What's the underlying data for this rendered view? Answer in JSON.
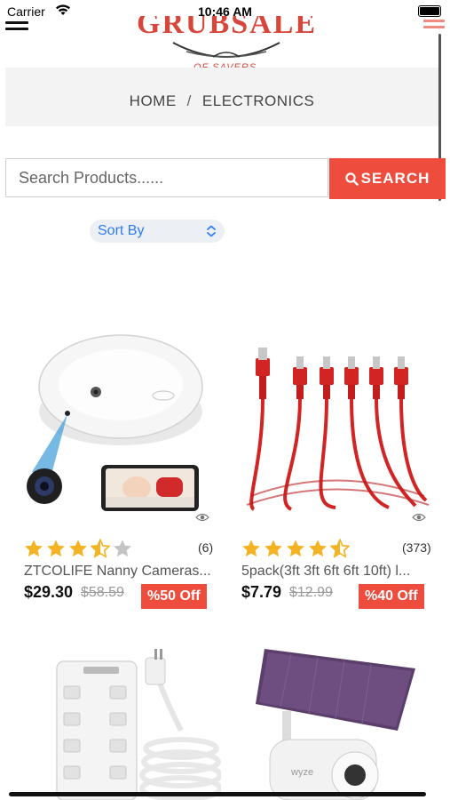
{
  "status_bar": {
    "carrier": "Carrier",
    "time": "10:46 AM"
  },
  "header": {
    "logo_text": "GRUBSALE",
    "logo_sub": "OF SAVERS"
  },
  "breadcrumb": {
    "home": "HOME",
    "separator": "/",
    "current": "ELECTRONICS"
  },
  "search": {
    "placeholder": "Search Products......",
    "button_label": "SEARCH"
  },
  "sort": {
    "label": "Sort By"
  },
  "products": [
    {
      "title": "ZTCOLIFE Nanny Cameras...",
      "rating": 3.5,
      "review_count": "(6)",
      "price": "$29.30",
      "old_price": "$58.59",
      "discount": "%50 Off"
    },
    {
      "title": "5pack(3ft 3ft 6ft 6ft 10ft) l...",
      "rating": 4.5,
      "review_count": "(373)",
      "price": "$7.79",
      "old_price": "$12.99",
      "discount": "%40 Off"
    },
    {
      "title": "",
      "partial": true
    },
    {
      "title": "",
      "partial": true
    }
  ],
  "colors": {
    "accent": "#ee4d3e",
    "star": "#f4b322",
    "link": "#2d7cf6"
  },
  "icons": [
    "wifi-icon",
    "battery-icon",
    "menu-icon",
    "hamburger-icon",
    "search-icon",
    "chevron-updown-icon",
    "eye-icon",
    "star-icon"
  ]
}
